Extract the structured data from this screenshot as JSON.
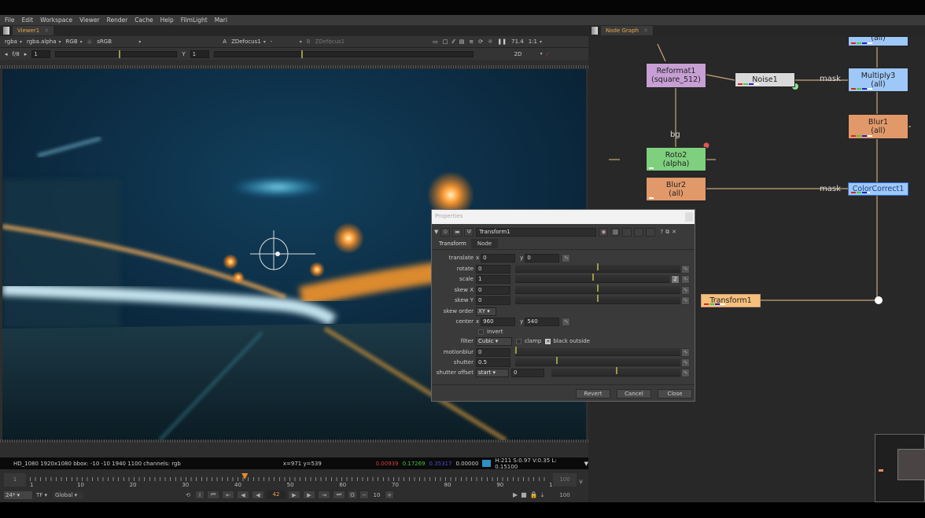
{
  "menu": [
    "File",
    "Edit",
    "Workspace",
    "Viewer",
    "Render",
    "Cache",
    "Help",
    "FilmLight",
    "Mari"
  ],
  "viewer": {
    "tab_label": "Viewer1",
    "channels": "rgba",
    "alpha_channel": "rgba.alpha",
    "colorspace": "RGB",
    "lut": "sRGB",
    "input_a_label": "A",
    "input_a": "ZDefocus1",
    "compare_mode": "-",
    "input_b_label": "B",
    "input_b": "ZDefocus1",
    "zoom": "71.4",
    "ratio": "1:1",
    "fstop": "f/8",
    "gain": "1",
    "gamma_label": "Y",
    "gamma": "1",
    "view_mode": "2D",
    "info": "HD_1080 1920x1080  bbox: -10 -10 1940 1100 channels: rgb",
    "coords": "x=971 y=539",
    "pixel_r": "0.00939",
    "pixel_g": "0.17269",
    "pixel_b": "0.35317",
    "pixel_a": "0.00000",
    "swatch_color": "#2e8fc4",
    "hsvl": "H:211 S:0.97 V:0.35  L: 0.15100"
  },
  "timeline": {
    "start_frame": "1",
    "end_frame": "100",
    "end_frame2": "100",
    "ticks": [
      "1",
      "10",
      "20",
      "30",
      "40",
      "50",
      "60",
      "70",
      "80",
      "90",
      "100"
    ],
    "current_frame": "42",
    "current_fraction": 0.414,
    "fps": "24*",
    "tf": "TF",
    "range_mode": "Global",
    "step": "10"
  },
  "node_graph": {
    "tab_label": "Node Graph",
    "nodes": [
      {
        "id": "reformat",
        "name": "Reformat1",
        "sub": "(square_512)",
        "color": "#c79fd4"
      },
      {
        "id": "noise",
        "name": "Noise1",
        "sub": "",
        "color": "#d9d9d9"
      },
      {
        "id": "top",
        "name": "",
        "sub": "(all)",
        "color": "#9ec8f7"
      },
      {
        "id": "multiply",
        "name": "Multiply3",
        "sub": "(all)",
        "color": "#9ec8f7"
      },
      {
        "id": "blur1",
        "name": "Blur1",
        "sub": "(all)",
        "color": "#e2996a"
      },
      {
        "id": "roto",
        "name": "Roto2",
        "sub": "(alpha)",
        "color": "#7ed07e"
      },
      {
        "id": "blur2",
        "name": "Blur2",
        "sub": "(all)",
        "color": "#e2996a"
      },
      {
        "id": "colorcorrect",
        "name": "ColorCorrect1",
        "sub": "",
        "color": "#9ec8f7"
      },
      {
        "id": "transform",
        "name": "Transform1",
        "sub": "",
        "color": "#f6c07c"
      }
    ],
    "labels": {
      "mask1": "mask",
      "mask2": "mask",
      "bg": "bg"
    }
  },
  "properties": {
    "window_title": "Properties",
    "node_name": "Transform1",
    "tabs": [
      "Transform",
      "Node"
    ],
    "translate_label": "translate",
    "translate_x": "0",
    "translate_y": "0",
    "rotate_label": "rotate",
    "rotate": "0",
    "scale_label": "scale",
    "scale": "1",
    "scale_dim_btn": "2",
    "skewx_label": "skew X",
    "skewx": "0",
    "skewy_label": "skew Y",
    "skewy": "0",
    "skew_order_label": "skew order",
    "skew_order": "XY",
    "center_label": "center",
    "center_x": "960",
    "center_y": "540",
    "invert_label": "invert",
    "invert": false,
    "filter_label": "filter",
    "filter": "Cubic",
    "clamp_label": "clamp",
    "clamp": false,
    "black_outside_label": "black outside",
    "black_outside": true,
    "motionblur_label": "motionblur",
    "motionblur": "0",
    "shutter_label": "shutter",
    "shutter": "0.5",
    "shutter_offset_label": "shutter offset",
    "shutter_offset": "start",
    "shutter_custom": "0",
    "x_label": "x",
    "y_label": "y",
    "buttons": {
      "revert": "Revert",
      "cancel": "Cancel",
      "close": "Close"
    }
  }
}
